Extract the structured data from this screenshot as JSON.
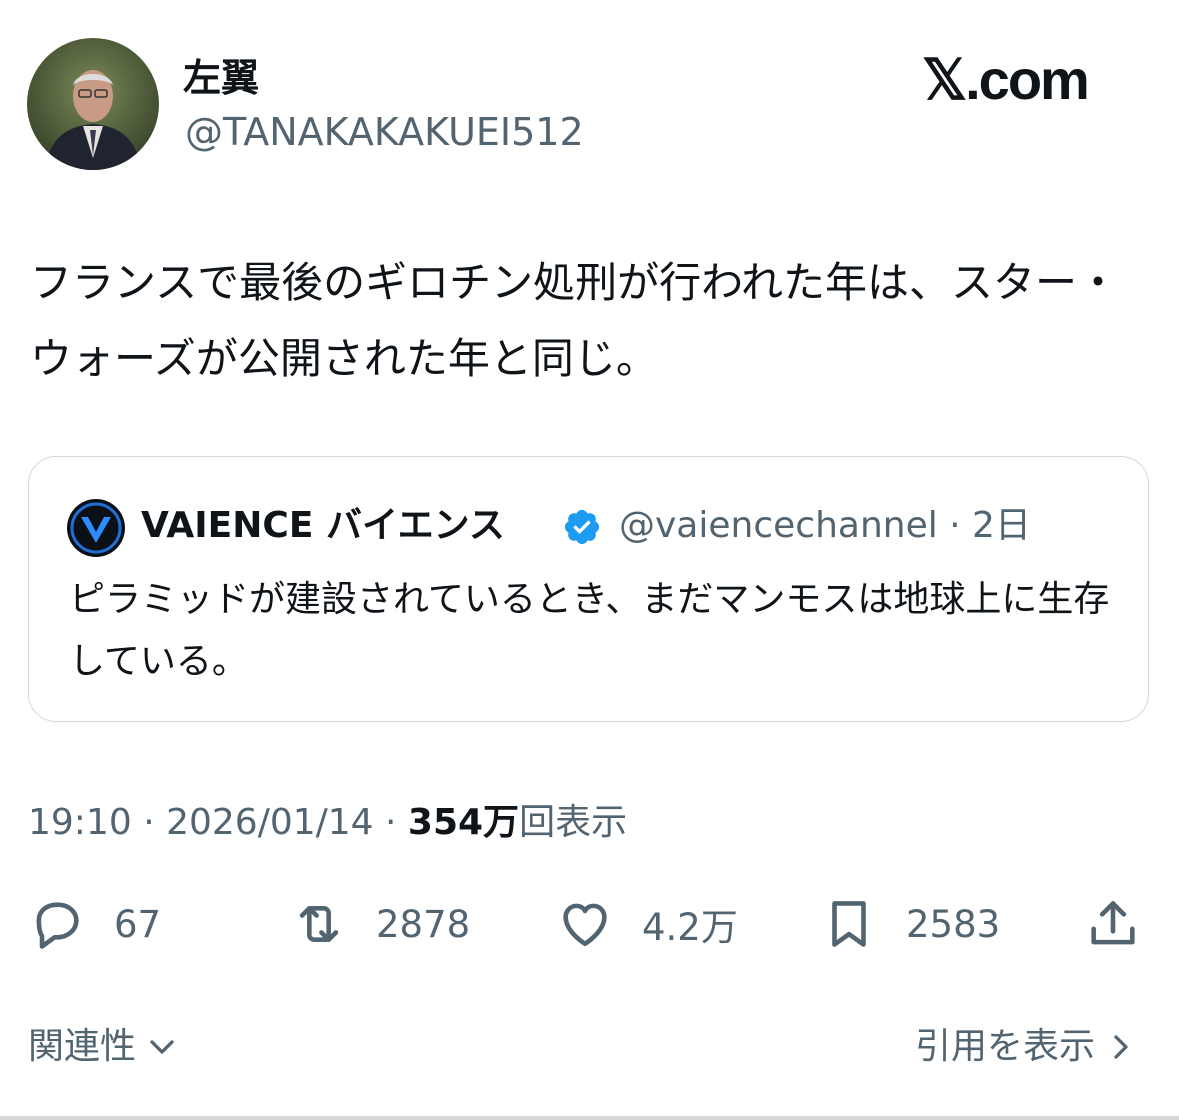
{
  "author": {
    "display_name": "左翼",
    "handle": "@TANAKAKAKUEI512",
    "avatar_icon": "user-photo"
  },
  "brand": {
    "logo_text": "𝕏.com"
  },
  "tweet": {
    "text": "フランスで最後のギロチン処刑が行われた年は、スター・ウォーズが公開された年と同じ。"
  },
  "quoted": {
    "display_name": "VAIENCE バイエンス",
    "verified_icon": "verified-badge-icon",
    "handle_time": "@vaiencechannel · 2日",
    "text": "ピラミッドが建設されているとき、まだマンモスは地球上に生存している。"
  },
  "meta": {
    "time_date": "19:10 · 2026/01/14 · ",
    "views_count": "354万",
    "views_label": "回表示"
  },
  "actions": {
    "replies": "67",
    "reposts": "2878",
    "likes": "4.2万",
    "bookmarks": "2583"
  },
  "footer": {
    "related_label": "関連性",
    "quotes_label": "引用を表示"
  },
  "colors": {
    "text": "#0f1419",
    "secondary": "#536471",
    "border": "#cfd9de",
    "verified": "#1d9bf0"
  }
}
